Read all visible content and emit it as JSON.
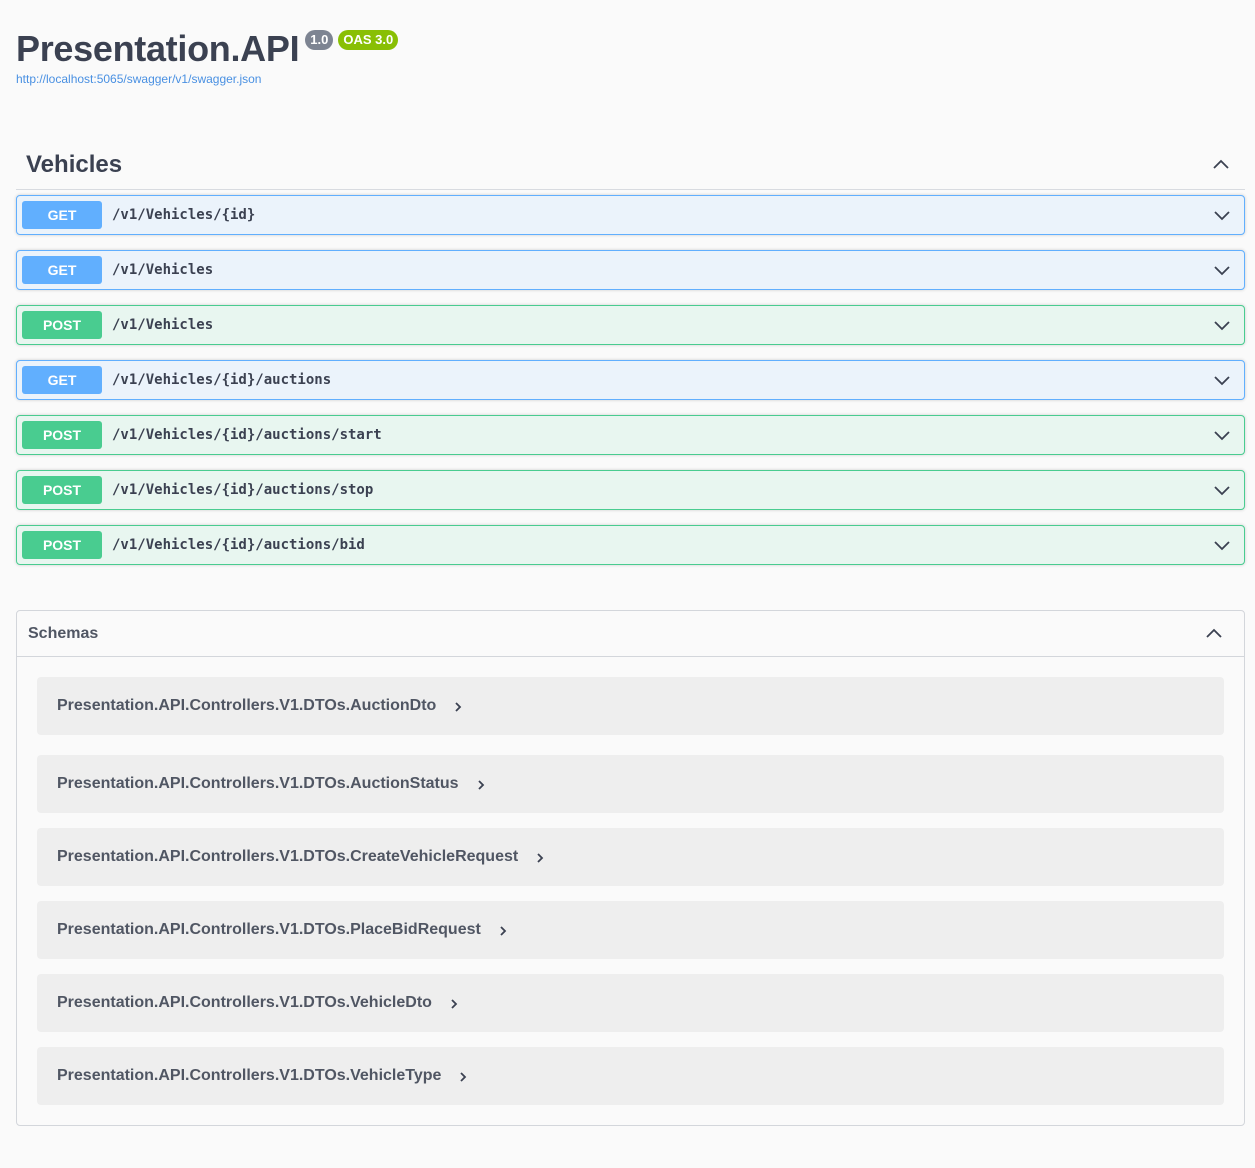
{
  "info": {
    "title": "Presentation.API",
    "version_badge": "1.0",
    "oas_badge": "OAS 3.0",
    "spec_url": "http://localhost:5065/swagger/v1/swagger.json"
  },
  "tag": {
    "name": "Vehicles",
    "toggle_icon": "chevron-up-icon"
  },
  "operations": [
    {
      "method": "GET",
      "path": "/v1/Vehicles/{id}"
    },
    {
      "method": "GET",
      "path": "/v1/Vehicles"
    },
    {
      "method": "POST",
      "path": "/v1/Vehicles"
    },
    {
      "method": "GET",
      "path": "/v1/Vehicles/{id}/auctions"
    },
    {
      "method": "POST",
      "path": "/v1/Vehicles/{id}/auctions/start"
    },
    {
      "method": "POST",
      "path": "/v1/Vehicles/{id}/auctions/stop"
    },
    {
      "method": "POST",
      "path": "/v1/Vehicles/{id}/auctions/bid"
    }
  ],
  "schemas": {
    "title": "Schemas",
    "models": [
      "Presentation.API.Controllers.V1.DTOs.AuctionDto",
      "Presentation.API.Controllers.V1.DTOs.AuctionStatus",
      "Presentation.API.Controllers.V1.DTOs.CreateVehicleRequest",
      "Presentation.API.Controllers.V1.DTOs.PlaceBidRequest",
      "Presentation.API.Controllers.V1.DTOs.VehicleDto",
      "Presentation.API.Controllers.V1.DTOs.VehicleType"
    ]
  },
  "colors": {
    "get": "#61affe",
    "post": "#49cc90",
    "text": "#3b4151",
    "link": "#4990e2",
    "oas_badge": "#89bf04",
    "version_badge": "#7d8492"
  }
}
